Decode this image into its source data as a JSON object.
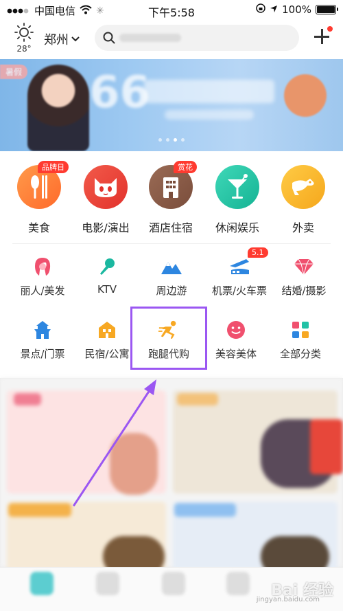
{
  "status_bar": {
    "carrier": "中国电信",
    "time": "下午5:58",
    "battery": "100%"
  },
  "header": {
    "temperature": "28°",
    "city": "郑州",
    "weather_icon": "sun-icon",
    "search_placeholder": ""
  },
  "banner": {
    "tag": "暑假",
    "headline": "66"
  },
  "primary_categories": [
    {
      "label": "美食",
      "badge": "品牌日",
      "color": "#ff7d3b",
      "icon": "utensils-icon"
    },
    {
      "label": "电影/演出",
      "badge": "",
      "color": "#ea3f35",
      "icon": "cat-face-icon"
    },
    {
      "label": "酒店住宿",
      "badge": "赏花",
      "color": "#8b5a45",
      "icon": "building-icon"
    },
    {
      "label": "休闲娱乐",
      "badge": "",
      "color": "#21c2a6",
      "icon": "cocktail-icon"
    },
    {
      "label": "外卖",
      "badge": "",
      "color": "#f7b62b",
      "icon": "kangaroo-icon"
    }
  ],
  "secondary_categories": [
    {
      "label": "丽人/美发",
      "badge": "",
      "icon": "woman-icon",
      "color": "#f0506e"
    },
    {
      "label": "KTV",
      "badge": "",
      "icon": "microphone-icon",
      "color": "#1bb8a0"
    },
    {
      "label": "周边游",
      "badge": "",
      "icon": "mountain-icon",
      "color": "#2d86e0"
    },
    {
      "label": "机票/火车票",
      "badge": "5.1",
      "icon": "train-icon",
      "color": "#2d86e0"
    },
    {
      "label": "结婚/摄影",
      "badge": "",
      "icon": "diamond-icon",
      "color": "#f0506e"
    },
    {
      "label": "景点/门票",
      "badge": "",
      "icon": "pagoda-icon",
      "color": "#2d86e0"
    },
    {
      "label": "民宿/公寓",
      "badge": "",
      "icon": "house-icon",
      "color": "#f7a823"
    },
    {
      "label": "跑腿代购",
      "badge": "",
      "icon": "runner-icon",
      "color": "#f7a823"
    },
    {
      "label": "美容美体",
      "badge": "",
      "icon": "smile-icon",
      "color": "#f0506e"
    },
    {
      "label": "全部分类",
      "badge": "",
      "icon": "grid-icon",
      "color": "#f7a823"
    }
  ],
  "annotation": {
    "highlight_color": "#9b57f2"
  },
  "watermark": {
    "text": "Bai 经验",
    "sub": "jingyan.baidu.com"
  }
}
